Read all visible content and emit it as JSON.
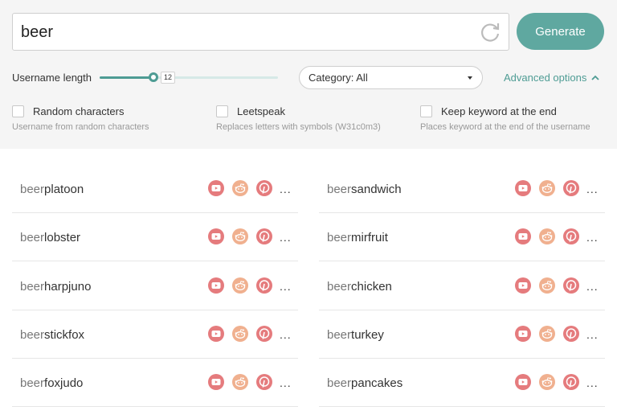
{
  "search": {
    "value": "beer"
  },
  "generate_label": "Generate",
  "username_length": {
    "label": "Username length",
    "value": 12,
    "min": 0,
    "max": 40
  },
  "category": {
    "selected": "Category: All"
  },
  "advanced_label": "Advanced options",
  "options": [
    {
      "label": "Random characters",
      "description": "Username from random characters",
      "checked": false
    },
    {
      "label": "Leetspeak",
      "description": "Replaces letters with symbols (W31c0m3)",
      "checked": false
    },
    {
      "label": "Keep keyword at the end",
      "description": "Places keyword at the end of the username",
      "checked": false
    }
  ],
  "keyword": "beer",
  "results": {
    "left": [
      "platoon",
      "lobster",
      "harpjuno",
      "stickfox",
      "foxjudo"
    ],
    "right": [
      "sandwich",
      "mirfruit",
      "chicken",
      "turkey",
      "pancakes"
    ]
  },
  "more_label": "...",
  "icons": [
    "youtube-icon",
    "reddit-icon",
    "pinterest-icon"
  ],
  "colors": {
    "accent": "#5fa8a0",
    "youtube": "#e57b7d",
    "reddit": "#f0b08f",
    "pinterest": "#e57b7d"
  }
}
